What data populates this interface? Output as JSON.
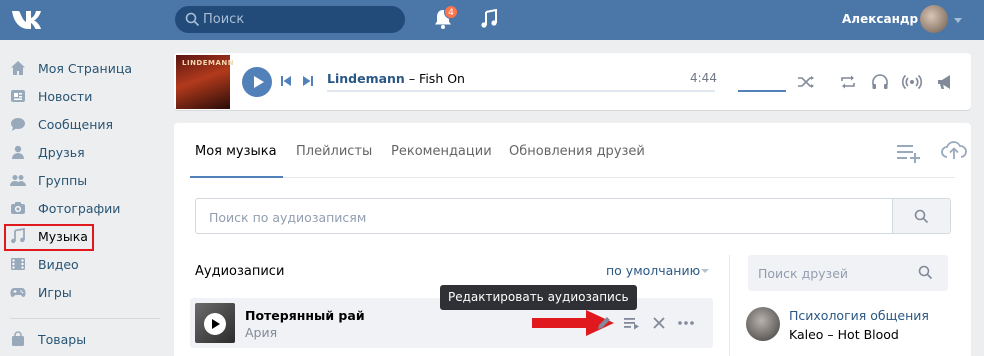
{
  "header": {
    "search_placeholder": "Поиск",
    "notifications_count": "4",
    "user_name": "Александр"
  },
  "sidebar": {
    "items": [
      {
        "label": "Моя Страница",
        "icon": "home-icon"
      },
      {
        "label": "Новости",
        "icon": "news-icon"
      },
      {
        "label": "Сообщения",
        "icon": "messages-icon"
      },
      {
        "label": "Друзья",
        "icon": "friend-icon"
      },
      {
        "label": "Группы",
        "icon": "groups-icon"
      },
      {
        "label": "Фотографии",
        "icon": "camera-icon"
      },
      {
        "label": "Музыка",
        "icon": "music-note-icon"
      },
      {
        "label": "Видео",
        "icon": "video-icon"
      },
      {
        "label": "Игры",
        "icon": "gamepad-icon"
      }
    ],
    "goods": {
      "label": "Товары",
      "icon": "shopping-bag-icon"
    }
  },
  "player": {
    "cover_text": "LINDEMANN",
    "artist": "Lindemann",
    "separator": " – ",
    "title": "Fish On",
    "duration": "4:44"
  },
  "music": {
    "tabs": [
      "Моя музыка",
      "Плейлисты",
      "Рекомендации",
      "Обновления друзей"
    ],
    "search_placeholder": "Поиск по аудиозаписям",
    "section_title": "Аудиозаписи",
    "sort_label": "по умолчанию",
    "tooltip": "Редактировать аудиозапись",
    "row": {
      "title": "Потерянный рай",
      "artist": "Ария"
    },
    "friends_search_placeholder": "Поиск друзей",
    "friend": {
      "name": "Психология общения",
      "track": "Kaleo – Hot Blood"
    }
  },
  "colors": {
    "header": "#4a76a8",
    "accent": "#5181b8",
    "highlight_box": "#e0191f",
    "arrow": "#e0191f"
  }
}
